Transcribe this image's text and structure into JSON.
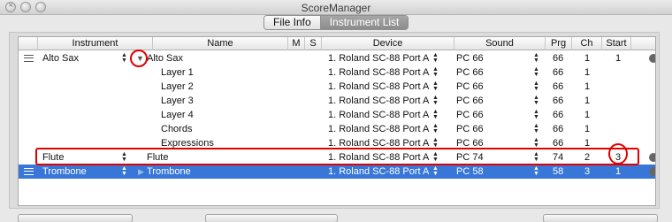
{
  "window": {
    "title": "ScoreManager"
  },
  "tabs": [
    {
      "label": "File Info",
      "active": false
    },
    {
      "label": "Instrument List",
      "active": true
    }
  ],
  "columns": [
    "Instrument",
    "Name",
    "M",
    "S",
    "Device",
    "Sound",
    "Prg",
    "Ch",
    "Start"
  ],
  "rows": [
    {
      "instrument": "Alto Sax",
      "name": "Alto Sax",
      "device": "1. Roland SC-88 Port A",
      "sound": "PC 66",
      "prg": "66",
      "ch": "1",
      "start": "1"
    },
    {
      "instrument": "",
      "name": "Layer 1",
      "device": "1. Roland SC-88 Port A",
      "sound": "PC 66",
      "prg": "66",
      "ch": "1",
      "start": ""
    },
    {
      "instrument": "",
      "name": "Layer 2",
      "device": "1. Roland SC-88 Port A",
      "sound": "PC 66",
      "prg": "66",
      "ch": "1",
      "start": ""
    },
    {
      "instrument": "",
      "name": "Layer 3",
      "device": "1. Roland SC-88 Port A",
      "sound": "PC 66",
      "prg": "66",
      "ch": "1",
      "start": ""
    },
    {
      "instrument": "",
      "name": "Layer 4",
      "device": "1. Roland SC-88 Port A",
      "sound": "PC 66",
      "prg": "66",
      "ch": "1",
      "start": ""
    },
    {
      "instrument": "",
      "name": "Chords",
      "device": "1. Roland SC-88 Port A",
      "sound": "PC 66",
      "prg": "66",
      "ch": "1",
      "start": ""
    },
    {
      "instrument": "",
      "name": "Expressions",
      "device": "1. Roland SC-88 Port A",
      "sound": "PC 66",
      "prg": "66",
      "ch": "1",
      "start": ""
    },
    {
      "instrument": "Flute",
      "name": "Flute",
      "device": "1. Roland SC-88 Port A",
      "sound": "PC 74",
      "prg": "74",
      "ch": "2",
      "start": "3"
    },
    {
      "instrument": "Trombone",
      "name": "Trombone",
      "device": "1. Roland SC-88 Port A",
      "sound": "PC 58",
      "prg": "58",
      "ch": "3",
      "start": "1"
    }
  ],
  "colors": {
    "selection": "#3876d8",
    "highlight": "#e00000"
  }
}
